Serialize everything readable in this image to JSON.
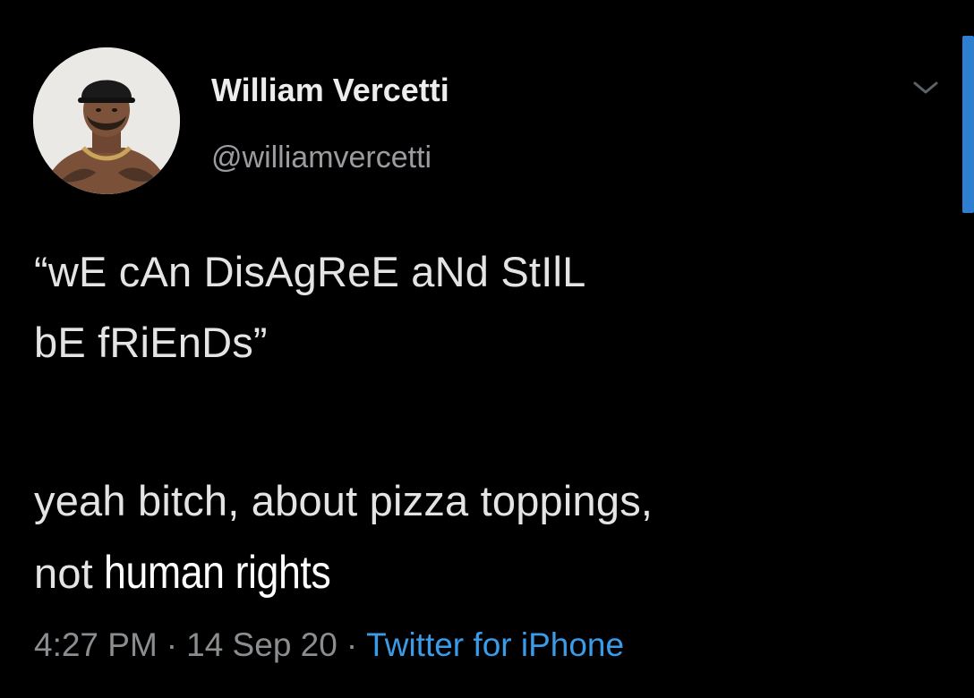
{
  "tweet": {
    "display_name": "William Vercetti",
    "handle": "@williamvercetti",
    "text_lines": [
      "“wE cAn DisAgReE aNd StIlL",
      "bE fRiEnDs”",
      "yeah bitch, about pizza toppings,",
      "not"
    ],
    "highlighted_text": "human rights",
    "time": "4:27 PM",
    "separator": "·",
    "date": "14 Sep 20",
    "source": "Twitter for iPhone"
  },
  "colors": {
    "background": "#000000",
    "text": "#e4e4e4",
    "meta_text": "#8b8e91",
    "link_blue": "#3a9be8",
    "scrollbar": "#2f7fd1"
  },
  "icons": {
    "menu": "chevron-down-icon",
    "avatar": "avatar"
  }
}
